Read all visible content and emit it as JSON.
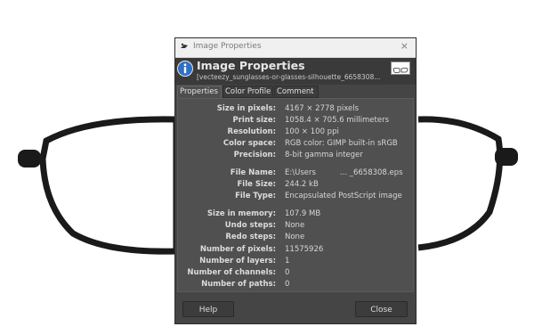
{
  "window": {
    "title": "Image Properties",
    "close_glyph": "×"
  },
  "header": {
    "title": "Image Properties",
    "subtitle": "[vecteezy_sunglasses-or-glasses-silhouette_6658308...",
    "icon": "info-icon"
  },
  "tabs": [
    {
      "label": "Properties",
      "active": true
    },
    {
      "label": "Color Profile",
      "active": false
    },
    {
      "label": "Comment",
      "active": false
    }
  ],
  "properties": [
    {
      "label": "Size in pixels:",
      "value": "4167 × 2778 pixels"
    },
    {
      "label": "Print size:",
      "value": "1058.4 × 705.6 millimeters"
    },
    {
      "label": "Resolution:",
      "value": "100 × 100 ppi"
    },
    {
      "label": "Color space:",
      "value": "RGB color: GIMP built-in sRGB"
    },
    {
      "label": "Precision:",
      "value": "8-bit gamma integer"
    },
    {
      "label": "File Name:",
      "value": "E:\\Users          ... _6658308.eps"
    },
    {
      "label": "File Size:",
      "value": "244.2 kB"
    },
    {
      "label": "File Type:",
      "value": "Encapsulated PostScript image"
    },
    {
      "label": "Size in memory:",
      "value": "107.9 MB"
    },
    {
      "label": "Undo steps:",
      "value": "None"
    },
    {
      "label": "Redo steps:",
      "value": "None"
    },
    {
      "label": "Number of pixels:",
      "value": "11575926"
    },
    {
      "label": "Number of layers:",
      "value": "1"
    },
    {
      "label": "Number of channels:",
      "value": "0"
    },
    {
      "label": "Number of paths:",
      "value": "0"
    }
  ],
  "buttons": {
    "help": "Help",
    "close": "Close"
  },
  "colors": {
    "dialog_bg": "#454545",
    "panel_bg": "#505050",
    "info_blue": "#2f6fc4",
    "canvas_stroke": "#1a1a1a"
  }
}
